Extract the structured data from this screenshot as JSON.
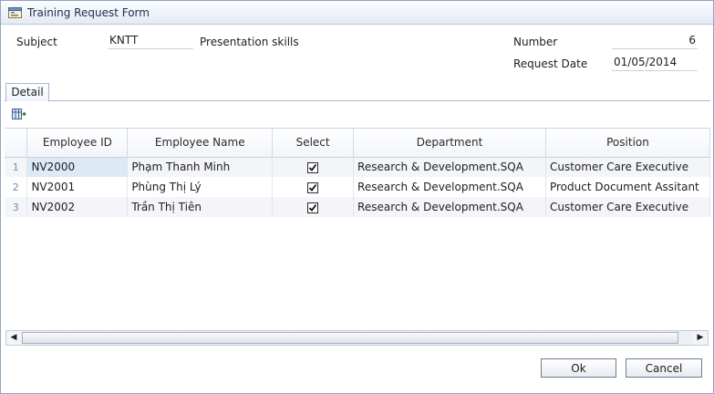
{
  "window": {
    "title": "Training Request Form"
  },
  "form": {
    "subject_label": "Subject",
    "subject_code": "KNTT",
    "subject_name": "Presentation skills",
    "number_label": "Number",
    "number_value": "6",
    "request_date_label": "Request Date",
    "request_date_value": "01/05/2014"
  },
  "tabs": [
    {
      "label": "Detail",
      "active": true
    }
  ],
  "grid": {
    "columns": [
      "Employee ID",
      "Employee Name",
      "Select",
      "Department",
      "Position"
    ],
    "rows": [
      {
        "num": "1",
        "id": "NV2000",
        "name": "Phạm  Thanh Minh",
        "selected": true,
        "department": "Research & Development.SQA",
        "position": "Customer Care Executive"
      },
      {
        "num": "2",
        "id": "NV2001",
        "name": "Phùng Thị  Lý",
        "selected": true,
        "department": "Research & Development.SQA",
        "position": "Product Document Assitant"
      },
      {
        "num": "3",
        "id": "NV2002",
        "name": "Trần Thị  Tiên",
        "selected": true,
        "department": "Research & Development.SQA",
        "position": "Customer Care Executive"
      }
    ]
  },
  "buttons": {
    "ok": "Ok",
    "cancel": "Cancel"
  },
  "icons": {
    "title": "form-icon",
    "grid_toolbar": "column-chooser-icon",
    "scroll_left": "arrow-left-icon",
    "scroll_right": "arrow-right-icon"
  }
}
